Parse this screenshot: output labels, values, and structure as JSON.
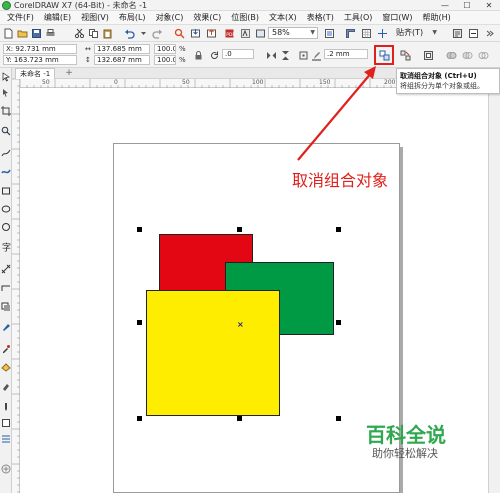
{
  "window": {
    "title": "CorelDRAW X7 (64-Bit) - 未命名 -1",
    "controls": [
      "—",
      "☐",
      "✕"
    ]
  },
  "menu": [
    "文件(F)",
    "编辑(E)",
    "视图(V)",
    "布局(L)",
    "对象(C)",
    "效果(C)",
    "位图(B)",
    "文本(X)",
    "表格(T)",
    "工具(O)",
    "窗口(W)",
    "帮助(H)"
  ],
  "toolbar": {
    "zoom": "58%",
    "snap_label": "贴齐(T)"
  },
  "property_bar": {
    "x": "X: 92.731 mm",
    "y": "Y: 163.723 mm",
    "width": "137.685 mm",
    "height": "132.687 mm",
    "scale_x": "100.0",
    "scale_y": "100.0",
    "percent": "%",
    "rotation": ".0",
    "outline_width": ".2 mm"
  },
  "tooltip": {
    "title": "取消组合对象 (Ctrl+U)",
    "description": "将组拆分为单个对象或组。"
  },
  "document_tab": "未命名 -1",
  "ruler": {
    "labels": [
      "50",
      "0",
      "50",
      "100",
      "150",
      "200"
    ]
  },
  "annotation": "取消组合对象",
  "watermark": {
    "title": "百科全说",
    "subtitle": "助你轻松解决"
  },
  "colors": {
    "red": "#e30613",
    "green": "#009a44",
    "yellow": "#ffed00",
    "annotation_red": "#e0201b"
  }
}
